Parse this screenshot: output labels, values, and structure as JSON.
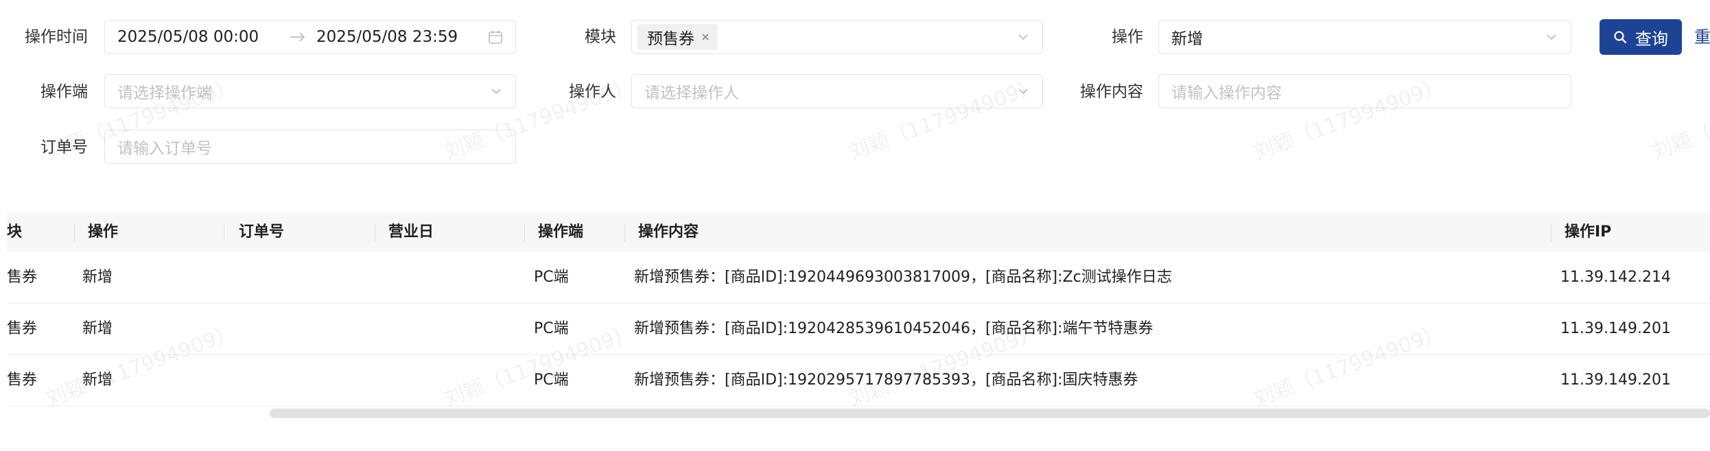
{
  "filters": {
    "op_time": {
      "label": "操作时间",
      "start": "2025/05/08 00:00",
      "end": "2025/05/08 23:59"
    },
    "module": {
      "label": "模块",
      "tag": "预售券"
    },
    "operation": {
      "label": "操作",
      "value": "新增"
    },
    "terminal": {
      "label": "操作端",
      "placeholder": "请选择操作端"
    },
    "operator": {
      "label": "操作人",
      "placeholder": "请选择操作人"
    },
    "content": {
      "label": "操作内容",
      "placeholder": "请输入操作内容"
    },
    "order_no": {
      "label": "订单号",
      "placeholder": "请输入订单号"
    }
  },
  "buttons": {
    "query": "查询",
    "reset": "重"
  },
  "table": {
    "columns": [
      "块",
      "操作",
      "订单号",
      "营业日",
      "操作端",
      "操作内容",
      "操作IP"
    ],
    "rows": [
      {
        "module": "售券",
        "operation": "新增",
        "order_no": "",
        "business_day": "",
        "terminal": "PC端",
        "content": "新增预售券：[商品ID]:1920449693003817009，[商品名称]:Zc测试操作日志",
        "ip": "11.39.142.214"
      },
      {
        "module": "售券",
        "operation": "新增",
        "order_no": "",
        "business_day": "",
        "terminal": "PC端",
        "content": "新增预售券：[商品ID]:1920428539610452046，[商品名称]:端午节特惠券",
        "ip": "11.39.149.201"
      },
      {
        "module": "售券",
        "operation": "新增",
        "order_no": "",
        "business_day": "",
        "terminal": "PC端",
        "content": "新增预售券：[商品ID]:1920295717897785393，[商品名称]:国庆特惠券",
        "ip": "11.39.149.201"
      }
    ]
  },
  "watermark": "刘颖（1179949​09）"
}
